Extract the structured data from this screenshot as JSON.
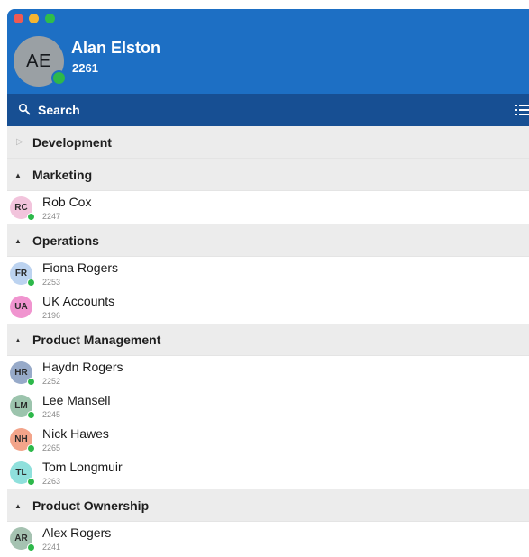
{
  "window_controls": {
    "close": "close-button",
    "minimize": "minimize-button",
    "maximize": "maximize-button"
  },
  "user": {
    "initials": "AE",
    "name": "Alan Elston",
    "extension": "2261",
    "status_color": "#2db84a"
  },
  "search": {
    "label": "Search",
    "icon": "search-icon",
    "list_icon": "list-icon"
  },
  "colors": {
    "header": "#1d6fc4",
    "searchbar": "#174f93",
    "group_bg": "#ececec",
    "presence_online": "#2db84a"
  },
  "groups": [
    {
      "name": "Development",
      "expanded": false,
      "contacts": []
    },
    {
      "name": "Marketing",
      "expanded": true,
      "contacts": [
        {
          "initials": "RC",
          "name": "Rob Cox",
          "extension": "2247",
          "avatar_color": "#f2c4dc",
          "online": true
        }
      ]
    },
    {
      "name": "Operations",
      "expanded": true,
      "contacts": [
        {
          "initials": "FR",
          "name": "Fiona Rogers",
          "extension": "2253",
          "avatar_color": "#bcd3f0",
          "online": true
        },
        {
          "initials": "UA",
          "name": "UK Accounts",
          "extension": "2196",
          "avatar_color": "#f094cf",
          "online": false
        }
      ]
    },
    {
      "name": "Product Management",
      "expanded": true,
      "contacts": [
        {
          "initials": "HR",
          "name": "Haydn Rogers",
          "extension": "2252",
          "avatar_color": "#97aac9",
          "online": true
        },
        {
          "initials": "LM",
          "name": "Lee Mansell",
          "extension": "2245",
          "avatar_color": "#9cc4ad",
          "online": true
        },
        {
          "initials": "NH",
          "name": "Nick Hawes",
          "extension": "2265",
          "avatar_color": "#f3a48a",
          "online": true
        },
        {
          "initials": "TL",
          "name": "Tom Longmuir",
          "extension": "2263",
          "avatar_color": "#8fe0dc",
          "online": true
        }
      ]
    },
    {
      "name": "Product Ownership",
      "expanded": true,
      "contacts": [
        {
          "initials": "AR",
          "name": "Alex Rogers",
          "extension": "2241",
          "avatar_color": "#a5c2b1",
          "online": true
        }
      ]
    }
  ]
}
